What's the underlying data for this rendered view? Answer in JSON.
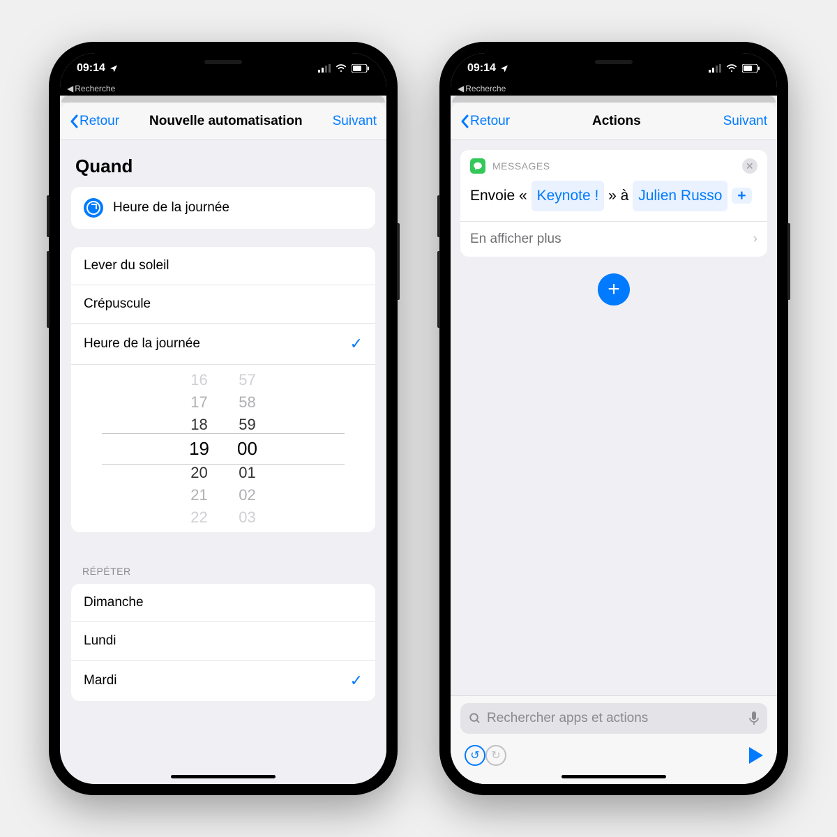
{
  "status": {
    "time": "09:14",
    "backApp": "Recherche"
  },
  "left": {
    "nav": {
      "back": "Retour",
      "title": "Nouvelle automatisation",
      "next": "Suivant"
    },
    "sectionTitle": "Quand",
    "trigger": {
      "label": "Heure de la journée"
    },
    "options": {
      "sunrise": "Lever du soleil",
      "sunset": "Crépuscule",
      "timeOfDay": "Heure de la journée"
    },
    "picker": {
      "hours": [
        "16",
        "17",
        "18",
        "19",
        "20",
        "21",
        "22"
      ],
      "minutes": [
        "57",
        "58",
        "59",
        "00",
        "01",
        "02",
        "03"
      ],
      "selectedHour": "19",
      "selectedMinute": "00"
    },
    "repeatLabel": "RÉPÉTER",
    "repeatDays": {
      "sunday": "Dimanche",
      "monday": "Lundi",
      "tuesday": "Mardi"
    }
  },
  "right": {
    "nav": {
      "back": "Retour",
      "title": "Actions",
      "next": "Suivant"
    },
    "action": {
      "app": "MESSAGES",
      "prefix": "Envoie «",
      "messageToken": "Keynote !",
      "middle": "» à",
      "recipient": "Julien Russo",
      "moreLabel": "En afficher plus"
    },
    "searchPlaceholder": "Rechercher apps et actions"
  }
}
